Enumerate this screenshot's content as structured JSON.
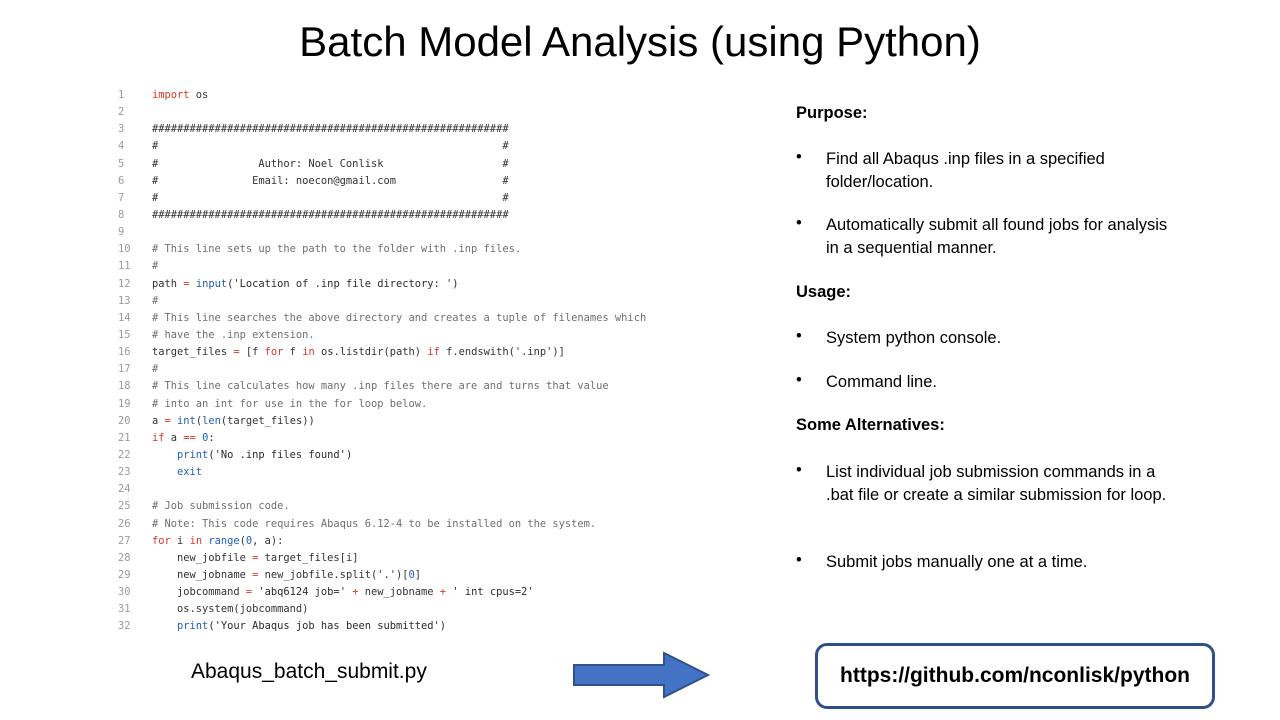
{
  "slide": {
    "title": "Batch Model Analysis (using Python)"
  },
  "code": {
    "lines": [
      {
        "n": "1",
        "parts": [
          {
            "t": "import",
            "c": "kw"
          },
          {
            "t": " os",
            "c": ""
          }
        ]
      },
      {
        "n": "2",
        "parts": []
      },
      {
        "n": "3",
        "parts": [
          {
            "t": "#########################################################",
            "c": ""
          }
        ]
      },
      {
        "n": "4",
        "parts": [
          {
            "t": "#                                                       #",
            "c": ""
          }
        ]
      },
      {
        "n": "5",
        "parts": [
          {
            "t": "#                Author: Noel Conlisk                   #",
            "c": ""
          }
        ]
      },
      {
        "n": "6",
        "parts": [
          {
            "t": "#               Email: noecon@gmail.com                 #",
            "c": ""
          }
        ]
      },
      {
        "n": "7",
        "parts": [
          {
            "t": "#                                                       #",
            "c": ""
          }
        ]
      },
      {
        "n": "8",
        "parts": [
          {
            "t": "#########################################################",
            "c": ""
          }
        ]
      },
      {
        "n": "9",
        "parts": []
      },
      {
        "n": "10",
        "parts": [
          {
            "t": "# This line sets up the path to the folder with .inp files.",
            "c": "cm"
          }
        ]
      },
      {
        "n": "11",
        "parts": [
          {
            "t": "#",
            "c": "cm"
          }
        ]
      },
      {
        "n": "12",
        "parts": [
          {
            "t": "path ",
            "c": ""
          },
          {
            "t": "=",
            "c": "kw"
          },
          {
            "t": " ",
            "c": ""
          },
          {
            "t": "input",
            "c": "bi"
          },
          {
            "t": "('Location of .inp file directory: ')",
            "c": "str"
          }
        ]
      },
      {
        "n": "13",
        "parts": [
          {
            "t": "#",
            "c": "cm"
          }
        ]
      },
      {
        "n": "14",
        "parts": [
          {
            "t": "# This line searches the above directory and creates a tuple of filenames which",
            "c": "cm"
          }
        ]
      },
      {
        "n": "15",
        "parts": [
          {
            "t": "# have the .inp extension.",
            "c": "cm"
          }
        ]
      },
      {
        "n": "16",
        "parts": [
          {
            "t": "target_files ",
            "c": ""
          },
          {
            "t": "=",
            "c": "kw"
          },
          {
            "t": " [f ",
            "c": ""
          },
          {
            "t": "for",
            "c": "kw"
          },
          {
            "t": " f ",
            "c": ""
          },
          {
            "t": "in",
            "c": "kw"
          },
          {
            "t": " os.listdir(path) ",
            "c": ""
          },
          {
            "t": "if",
            "c": "kw"
          },
          {
            "t": " f.endswith('.inp')]",
            "c": ""
          }
        ]
      },
      {
        "n": "17",
        "parts": [
          {
            "t": "#",
            "c": "cm"
          }
        ]
      },
      {
        "n": "18",
        "parts": [
          {
            "t": "# This line calculates how many .inp files there are and turns that value",
            "c": "cm"
          }
        ]
      },
      {
        "n": "19",
        "parts": [
          {
            "t": "# into an int for use in the for loop below.",
            "c": "cm"
          }
        ]
      },
      {
        "n": "20",
        "parts": [
          {
            "t": "a ",
            "c": ""
          },
          {
            "t": "=",
            "c": "kw"
          },
          {
            "t": " ",
            "c": ""
          },
          {
            "t": "int",
            "c": "bi"
          },
          {
            "t": "(",
            "c": ""
          },
          {
            "t": "len",
            "c": "bi"
          },
          {
            "t": "(target_files))",
            "c": ""
          }
        ]
      },
      {
        "n": "21",
        "parts": [
          {
            "t": "if",
            "c": "kw"
          },
          {
            "t": " a ",
            "c": ""
          },
          {
            "t": "==",
            "c": "kw"
          },
          {
            "t": " ",
            "c": ""
          },
          {
            "t": "0",
            "c": "num"
          },
          {
            "t": ":",
            "c": ""
          }
        ]
      },
      {
        "n": "22",
        "parts": [
          {
            "t": "    ",
            "c": ""
          },
          {
            "t": "print",
            "c": "bi"
          },
          {
            "t": "('No .inp files found')",
            "c": "str"
          }
        ]
      },
      {
        "n": "23",
        "parts": [
          {
            "t": "    ",
            "c": ""
          },
          {
            "t": "exit",
            "c": "bi"
          }
        ]
      },
      {
        "n": "24",
        "parts": []
      },
      {
        "n": "25",
        "parts": [
          {
            "t": "# Job submission code.",
            "c": "cm"
          }
        ]
      },
      {
        "n": "26",
        "parts": [
          {
            "t": "# Note: This code requires Abaqus 6.12-4 to be installed on the system.",
            "c": "cm"
          }
        ]
      },
      {
        "n": "27",
        "parts": [
          {
            "t": "for",
            "c": "kw"
          },
          {
            "t": " i ",
            "c": ""
          },
          {
            "t": "in",
            "c": "kw"
          },
          {
            "t": " ",
            "c": ""
          },
          {
            "t": "range",
            "c": "bi"
          },
          {
            "t": "(",
            "c": ""
          },
          {
            "t": "0",
            "c": "num"
          },
          {
            "t": ", a):",
            "c": ""
          }
        ]
      },
      {
        "n": "28",
        "parts": [
          {
            "t": "    new_jobfile ",
            "c": ""
          },
          {
            "t": "=",
            "c": "kw"
          },
          {
            "t": " target_files[i]",
            "c": ""
          }
        ]
      },
      {
        "n": "29",
        "parts": [
          {
            "t": "    new_jobname ",
            "c": ""
          },
          {
            "t": "=",
            "c": "kw"
          },
          {
            "t": " new_jobfile.split('.')[",
            "c": ""
          },
          {
            "t": "0",
            "c": "num"
          },
          {
            "t": "]",
            "c": ""
          }
        ]
      },
      {
        "n": "30",
        "parts": [
          {
            "t": "    jobcommand ",
            "c": ""
          },
          {
            "t": "=",
            "c": "kw"
          },
          {
            "t": " 'abq6124 job=' ",
            "c": "str"
          },
          {
            "t": "+",
            "c": "kw"
          },
          {
            "t": " new_jobname ",
            "c": ""
          },
          {
            "t": "+",
            "c": "kw"
          },
          {
            "t": " ' int cpus=2'",
            "c": "str"
          }
        ]
      },
      {
        "n": "31",
        "parts": [
          {
            "t": "    os.system(jobcommand)",
            "c": ""
          }
        ]
      },
      {
        "n": "32",
        "parts": [
          {
            "t": "    ",
            "c": ""
          },
          {
            "t": "print",
            "c": "bi"
          },
          {
            "t": "('Your Abaqus job has been submitted')",
            "c": "str"
          }
        ]
      }
    ]
  },
  "info": {
    "purpose_heading": "Purpose:",
    "purpose_bullets": [
      "Find all Abaqus .inp files in a specified folder/location.",
      "Automatically submit all found jobs for analysis in a sequential manner."
    ],
    "usage_heading": "Usage:",
    "usage_bullets": [
      "System python console.",
      "Command line."
    ],
    "alternatives_heading": "Some Alternatives:",
    "alternatives_bullets": [
      "List individual job submission commands in a .bat file or create a similar submission for loop.",
      "Submit jobs manually one at a time."
    ],
    "bullet_char": "•"
  },
  "footer": {
    "filename": "Abaqus_batch_submit.py",
    "link": "https://github.com/nconlisk/python"
  },
  "colors": {
    "arrow_fill": "#4472c4",
    "arrow_stroke": "#2f528f",
    "link_border": "#2f4f8a"
  }
}
